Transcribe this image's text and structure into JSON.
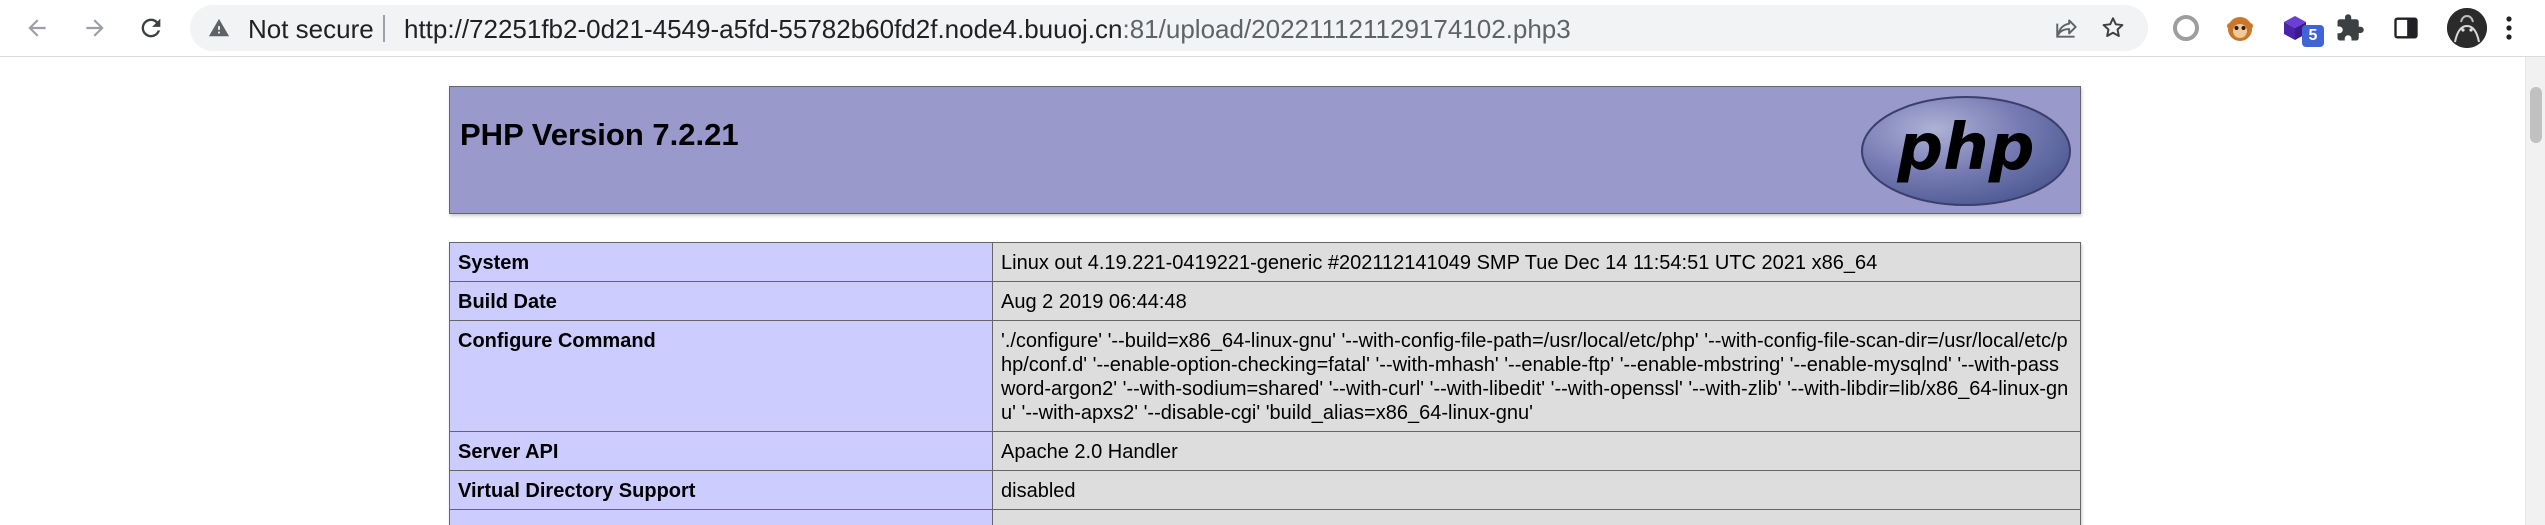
{
  "browser": {
    "security_status": "Not secure",
    "url_host": "http://72251fb2-0d21-4549-a5fd-55782b60fd2f.node4.buuoj.cn",
    "url_rest": ":81/upload/202211121129174102.php3",
    "extension_badge": "5",
    "icons": {
      "back": "arrow-left-icon",
      "forward": "arrow-right-icon",
      "reload": "reload-icon",
      "warning": "warning-triangle-icon",
      "share": "share-icon",
      "bookmark": "star-icon",
      "puzzle": "puzzle-piece-icon",
      "sidepanel": "side-panel-icon",
      "menu": "kebab-menu-icon"
    }
  },
  "page": {
    "title": "PHP Version 7.2.21",
    "logo_text": "php",
    "rows": [
      {
        "key": "System",
        "value": "Linux out 4.19.221-0419221-generic #202112141049 SMP Tue Dec 14 11:54:51 UTC 2021 x86_64"
      },
      {
        "key": "Build Date",
        "value": "Aug 2 2019 06:44:48"
      },
      {
        "key": "Configure Command",
        "value": "'./configure' '--build=x86_64-linux-gnu' '--with-config-file-path=/usr/local/etc/php' '--with-config-file-scan-dir=/usr/local/etc/php/conf.d' '--enable-option-checking=fatal' '--with-mhash' '--enable-ftp' '--enable-mbstring' '--enable-mysqlnd' '--with-password-argon2' '--with-sodium=shared' '--with-curl' '--with-libedit' '--with-openssl' '--with-zlib' '--with-libdir=lib/x86_64-linux-gnu' '--with-apxs2' '--disable-cgi' 'build_alias=x86_64-linux-gnu'"
      },
      {
        "key": "Server API",
        "value": "Apache 2.0 Handler"
      },
      {
        "key": "Virtual Directory Support",
        "value": "disabled"
      },
      {
        "key": "",
        "value": ""
      }
    ]
  },
  "colors": {
    "header_bg": "#9999cc",
    "key_cell_bg": "#ccccff",
    "value_cell_bg": "#dddddd",
    "omnibox_bg": "#f1f3f4"
  }
}
